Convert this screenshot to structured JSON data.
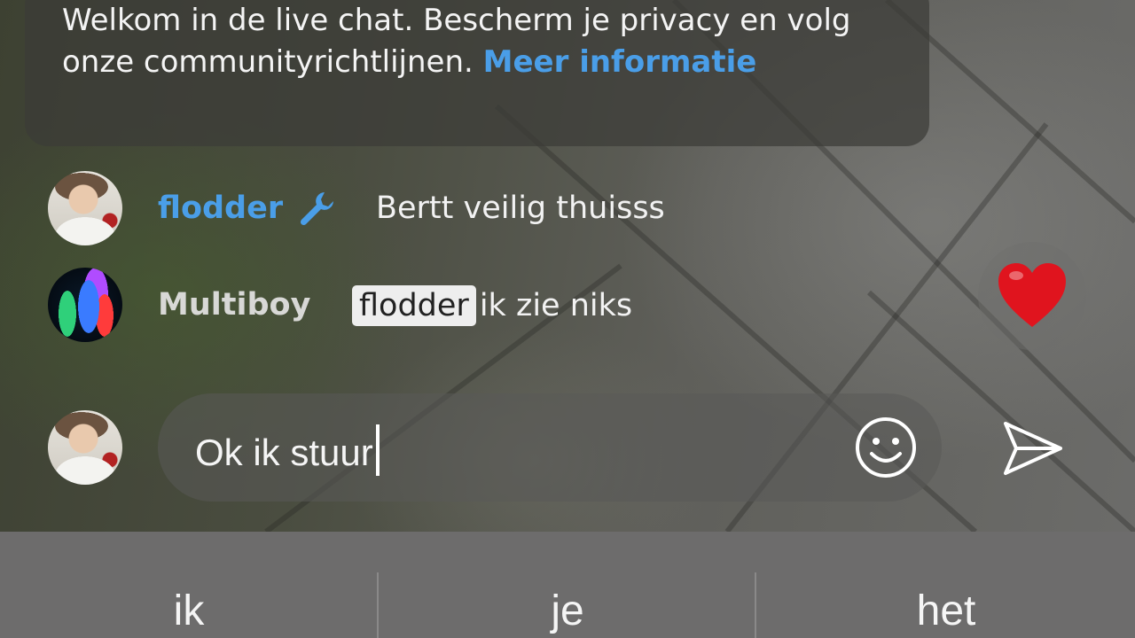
{
  "banner": {
    "text": "Welkom in de live chat. Bescherm je privacy en volg onze communityrichtlijnen.",
    "link_label": "Meer informatie"
  },
  "chat": {
    "messages": [
      {
        "username": "flodder",
        "badge_icon": "wrench-icon",
        "text": "Bertt veilig thuisss",
        "username_color": "#4a9ee8"
      },
      {
        "username": "Multiboy",
        "mention": "flodder",
        "text": "ik zie niks",
        "username_color": "#d8d8d6"
      }
    ]
  },
  "reaction": {
    "icon": "heart-icon",
    "color": "#e0141e"
  },
  "composer": {
    "value": "Ok ik stuur",
    "emoji_icon": "smiley-icon",
    "send_icon": "send-icon"
  },
  "keyboard": {
    "suggestions": [
      "ik",
      "je",
      "het"
    ]
  },
  "colors": {
    "link": "#4a9ee8",
    "mention_bg": "#eeeeee",
    "suggestion_bar": "#6d6c6c"
  }
}
